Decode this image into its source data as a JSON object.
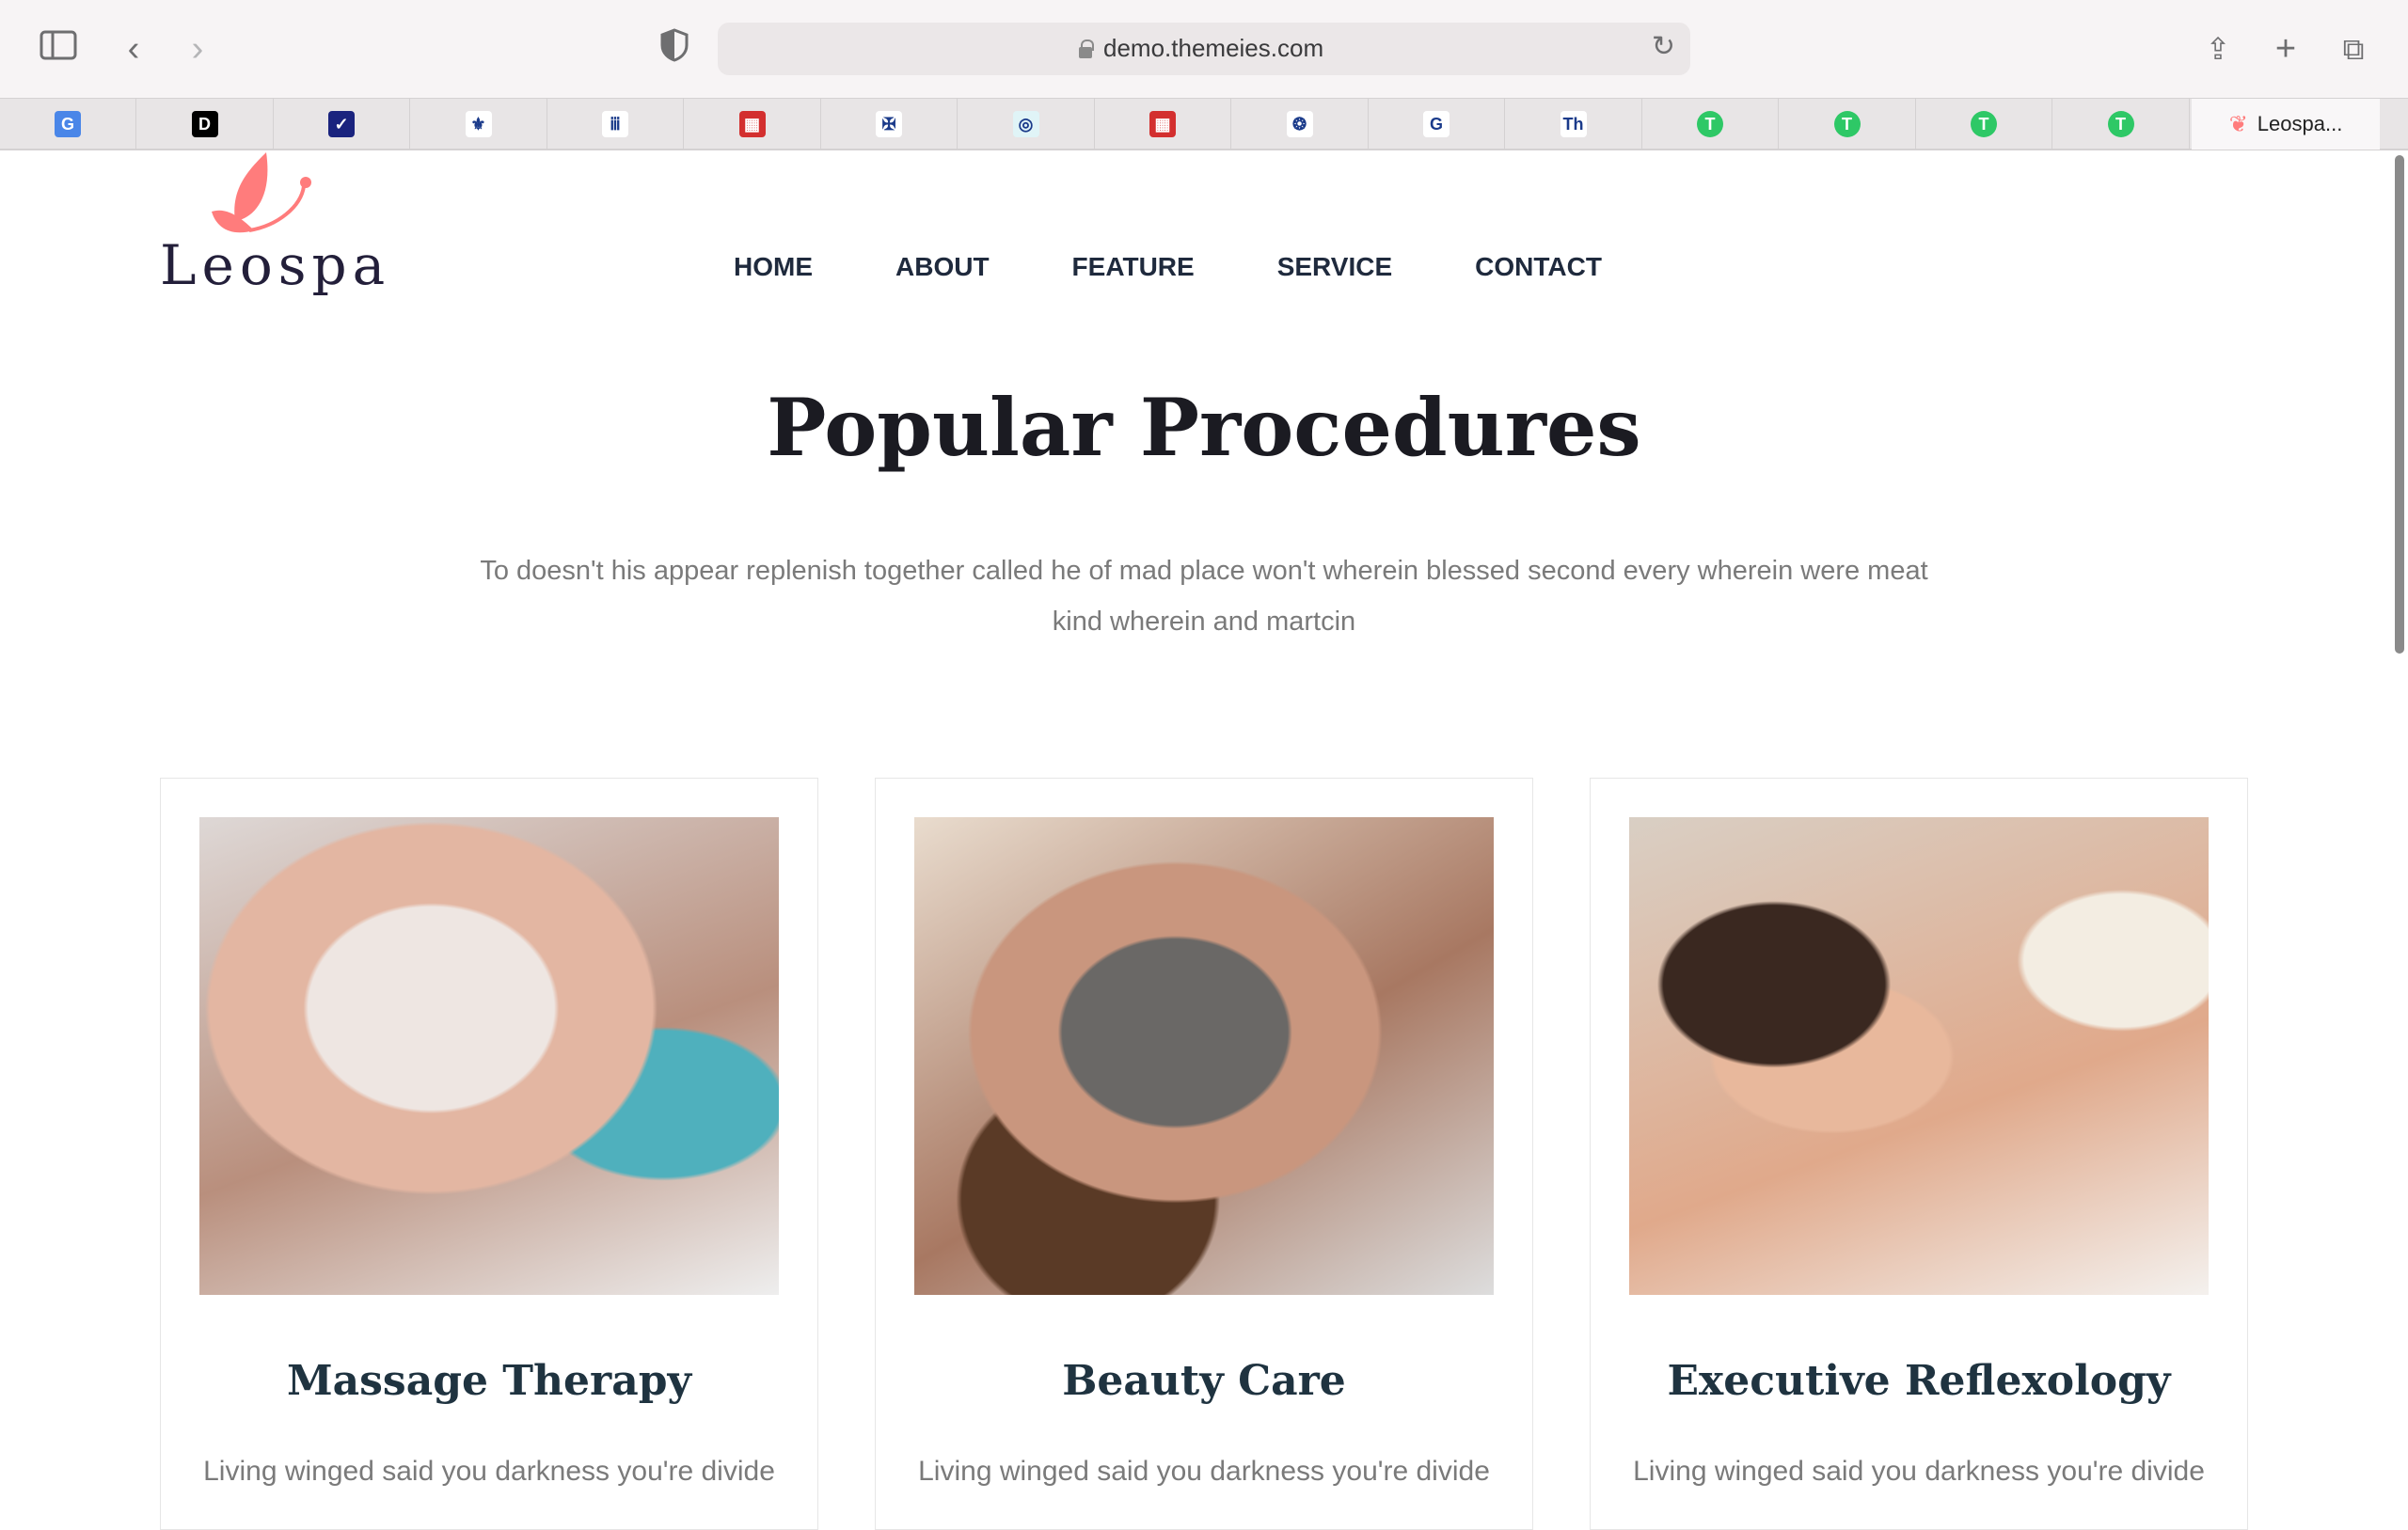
{
  "browser": {
    "url": "demo.themeies.com",
    "bookmarks": [
      {
        "icon": "google-translate-icon",
        "glyph": "G",
        "color": "#4a86e8"
      },
      {
        "icon": "d-logo-icon",
        "glyph": "D",
        "color": "#000000"
      },
      {
        "icon": "v-check-icon",
        "glyph": "✓",
        "color": "#1a237e"
      },
      {
        "icon": "fleur-icon",
        "glyph": "⚜",
        "color": "#ffffff"
      },
      {
        "icon": "columns-icon",
        "glyph": "ⅲ",
        "color": "#ffffff"
      },
      {
        "icon": "grid-flag-icon",
        "glyph": "▦",
        "color": "#d32f2f"
      },
      {
        "icon": "eagle-icon",
        "glyph": "✠",
        "color": "#ffffff"
      },
      {
        "icon": "mbe-icon",
        "glyph": "◎",
        "color": "#e0f4f7"
      },
      {
        "icon": "grid-flag-icon-2",
        "glyph": "▦",
        "color": "#d32f2f"
      },
      {
        "icon": "emblem-icon",
        "glyph": "❂",
        "color": "#ffffff"
      },
      {
        "icon": "google-icon",
        "glyph": "G",
        "color": "#ffffff"
      },
      {
        "icon": "th-icon",
        "glyph": "Th",
        "color": "#ffffff"
      },
      {
        "icon": "tether-icon",
        "glyph": "T",
        "color": "#2ec866"
      },
      {
        "icon": "tether-icon-2",
        "glyph": "T",
        "color": "#2ec866"
      },
      {
        "icon": "tether-icon-3",
        "glyph": "T",
        "color": "#2ec866"
      },
      {
        "icon": "tether-icon-4",
        "glyph": "T",
        "color": "#2ec866"
      }
    ],
    "active_tab": "Leospa..."
  },
  "site": {
    "logo": "Leospa",
    "nav": [
      "HOME",
      "ABOUT",
      "FEATURE",
      "SERVICE",
      "CONTACT"
    ],
    "title": "Popular Procedures",
    "intro": "To doesn't his appear replenish together called he of mad place won't wherein blessed second every wherein were meat kind wherein and martcin",
    "cards": [
      {
        "title": "Massage Therapy",
        "desc": "Living winged said you darkness you're divide"
      },
      {
        "title": "Beauty Care",
        "desc": "Living winged said you darkness you're divide"
      },
      {
        "title": "Executive Reflexology",
        "desc": "Living winged said you darkness you're divide"
      }
    ],
    "accent": "#ff7c7c"
  }
}
